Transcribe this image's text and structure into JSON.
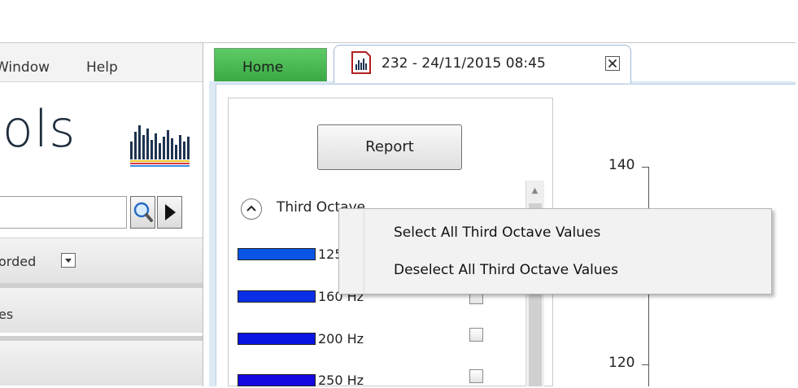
{
  "menubar": {
    "window_label": "Window",
    "help_label": "Help"
  },
  "logo": {
    "text": "ools"
  },
  "sidebar": {
    "sections": [
      {
        "label": "orded"
      },
      {
        "label": "es"
      },
      {
        "label": ""
      }
    ]
  },
  "tabs": {
    "home_label": "Home",
    "document_label": "232 - 24/11/2015 08:45"
  },
  "report": {
    "button_label": "Report"
  },
  "octave": {
    "header": "Third Octave",
    "items": [
      {
        "label": "125 Hz",
        "color": "#0a55e6"
      },
      {
        "label": "160 Hz",
        "color": "#0a2fe6"
      },
      {
        "label": "200 Hz",
        "color": "#0a14e0"
      },
      {
        "label": "250 Hz",
        "color": "#1608e0"
      }
    ]
  },
  "chart_axis": {
    "ticks": [
      "140",
      "120"
    ]
  },
  "context_menu": {
    "items": [
      {
        "label": "Select All Third Octave Values"
      },
      {
        "label": "Deselect All Third Octave Values"
      }
    ]
  },
  "colors": {
    "home_tab": "#47b34f",
    "accent_blue": "#0a2fe6"
  }
}
